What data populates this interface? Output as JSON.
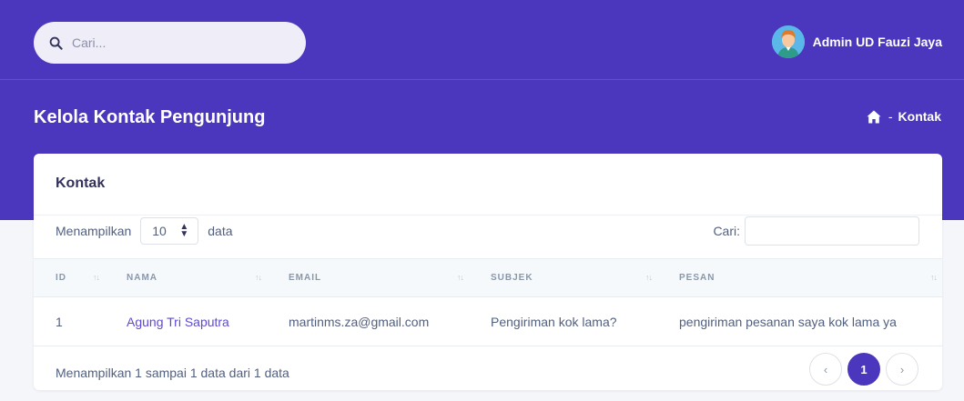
{
  "colors": {
    "hero": "#4a37bd",
    "accent": "#5e49d6",
    "background": "#f5f6fa"
  },
  "topbar": {
    "search_placeholder": "Cari...",
    "search_icon": "search-icon",
    "user_name": "Admin UD Fauzi Jaya",
    "avatar_icon": "user-avatar"
  },
  "header": {
    "title": "Kelola Kontak Pengunjung",
    "breadcrumb_icon": "home-icon",
    "breadcrumb_sep": "-",
    "breadcrumb_current": "Kontak"
  },
  "card": {
    "title": "Kontak",
    "length_prefix": "Menampilkan",
    "length_value": "10",
    "length_suffix": "data",
    "filter_label": "Cari:",
    "columns": [
      "ID",
      "NAMA",
      "EMAIL",
      "SUBJEK",
      "PESAN"
    ],
    "rows": [
      {
        "id": "1",
        "nama": "Agung Tri Saputra",
        "email": "martinms.za@gmail.com",
        "subjek": "Pengiriman kok lama?",
        "pesan": "pengiriman pesanan saya kok lama ya"
      }
    ],
    "info": "Menampilkan 1 sampai 1 data dari 1 data",
    "pagination": {
      "prev": "‹",
      "current": "1",
      "next": "›"
    }
  }
}
